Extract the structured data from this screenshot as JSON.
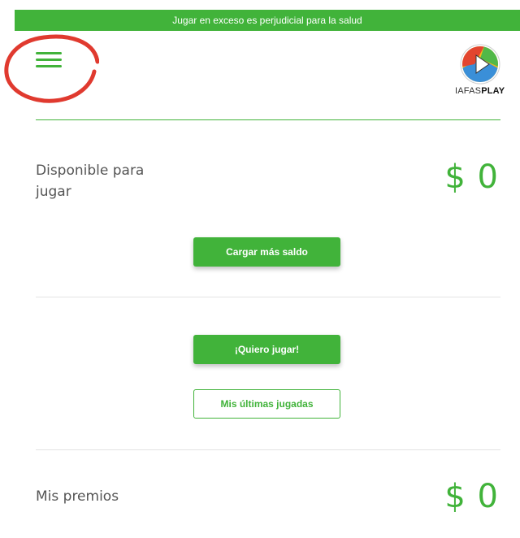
{
  "banner": {
    "text": "Jugar en exceso es perjudicial para la salud"
  },
  "header": {
    "menu_icon": "hamburger-menu-icon",
    "logo": {
      "text_light": "IAFAS",
      "text_bold": "PLAY"
    }
  },
  "balance": {
    "label": "Disponible para jugar",
    "label_line1": "Disponible para",
    "label_line2": "jugar",
    "amount": "$ 0",
    "reload_button": "Cargar más saldo"
  },
  "actions": {
    "play_button": "¡Quiero jugar!",
    "history_button": "Mis últimas jugadas"
  },
  "prizes": {
    "label": "Mis premios",
    "amount": "$ 0"
  },
  "colors": {
    "accent": "#41b33a",
    "annotation": "#e03a2f"
  }
}
